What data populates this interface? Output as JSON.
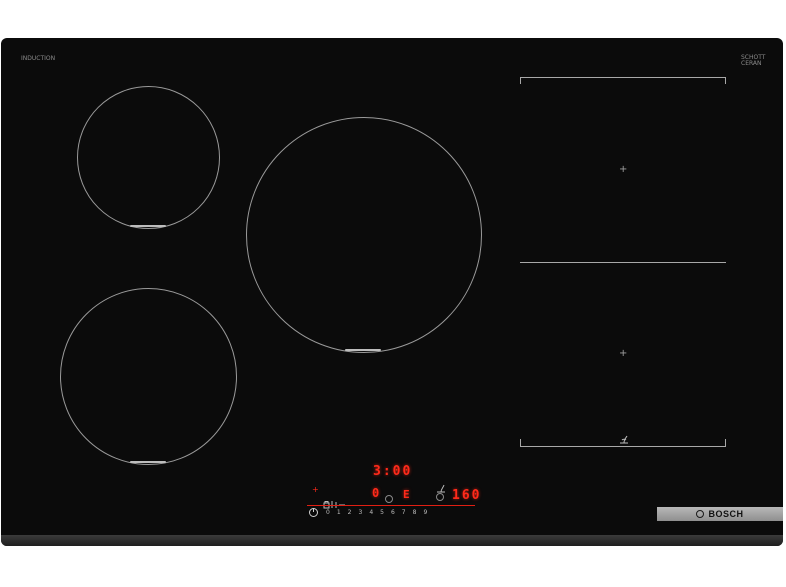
{
  "cooktop": {
    "type_label": "INDUCTION",
    "glass_label_line1": "SCHOTT",
    "glass_label_line2": "CERAN"
  },
  "display": {
    "timer": "3:00",
    "zone_level": "0",
    "zone_indicator": "E",
    "temperature": "160"
  },
  "power_scale": [
    "0",
    "1",
    "2",
    "3",
    "4",
    "5",
    "6",
    "7",
    "8",
    "9"
  ],
  "brand": "BOSCH",
  "colors": {
    "glass": "#0b0b0b",
    "display_red": "#ff2a1a",
    "rings": "#9a9a9a",
    "badge": "#a6a6a6"
  },
  "icons": [
    "power-icon",
    "lock-icon",
    "pan-sensor-icon",
    "frying-sensor-icon",
    "move-mode-icon"
  ]
}
